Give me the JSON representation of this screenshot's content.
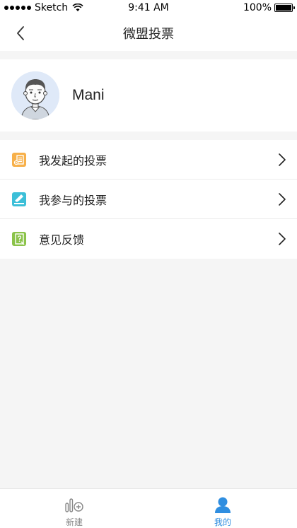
{
  "status_bar": {
    "carrier": "Sketch",
    "time": "9:41 AM",
    "battery": "100%",
    "battery_level": 1.0
  },
  "nav": {
    "title": "微盟投票",
    "back_icon": "chevron-left-icon"
  },
  "profile": {
    "name": "Mani",
    "avatar": "cartoon-avatar"
  },
  "menu": {
    "items": [
      {
        "label": "我发起的投票",
        "icon": "created-votes-icon",
        "color": "#f7b04a"
      },
      {
        "label": "我参与的投票",
        "icon": "joined-votes-icon",
        "color": "#3cbfd8"
      },
      {
        "label": "意见反馈",
        "icon": "feedback-icon",
        "color": "#8bc34a"
      }
    ]
  },
  "tabs": [
    {
      "label": "新建",
      "icon": "new-poll-icon",
      "active": false,
      "color": "#888888"
    },
    {
      "label": "我的",
      "icon": "person-icon",
      "active": true,
      "color": "#2f8ee0"
    }
  ]
}
